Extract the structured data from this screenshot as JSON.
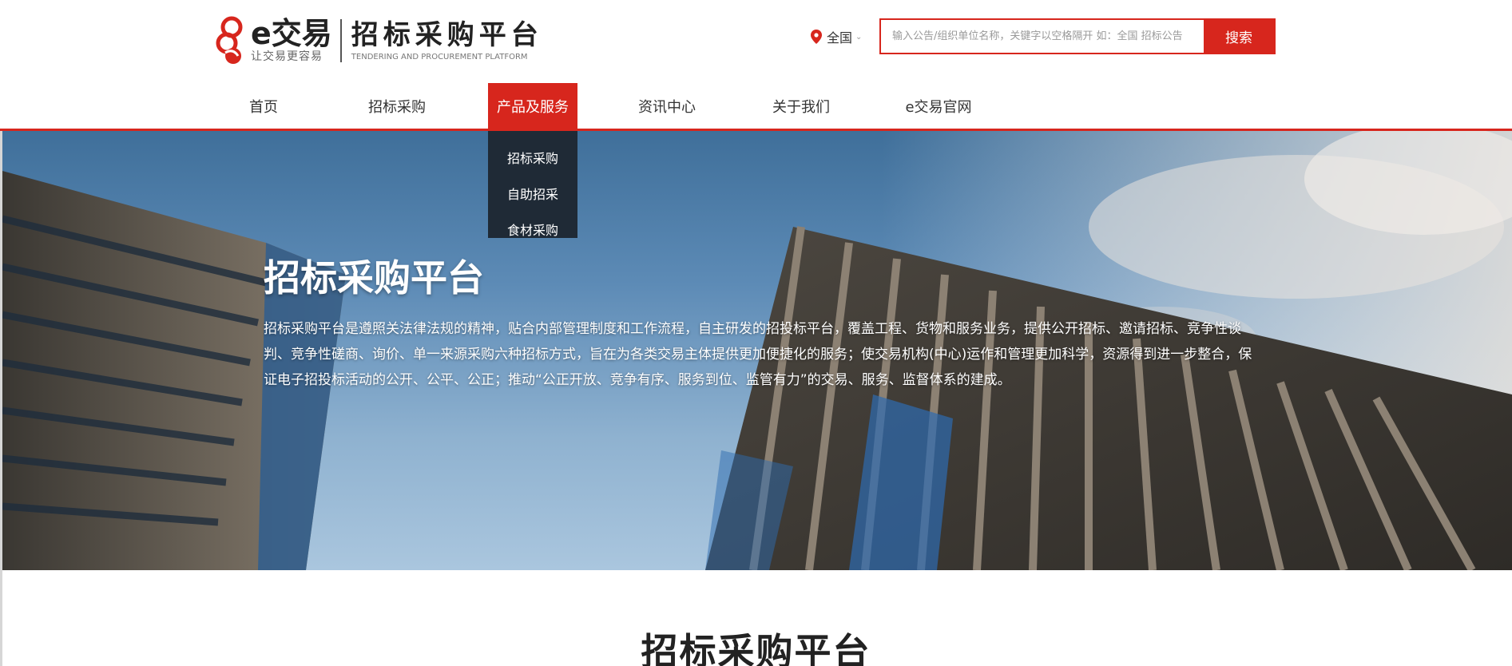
{
  "brand": {
    "e_name": "e交易",
    "slogan": "让交易更容易",
    "platform_name": "招标采购平台",
    "platform_en": "TENDERING AND PROCUREMENT PLATFORM",
    "accent_color": "#d7261d"
  },
  "header": {
    "region": {
      "label": "全国",
      "icon": "location-pin-icon"
    },
    "search": {
      "placeholder": "输入公告/组织单位名称，关键字以空格隔开 如：全国 招标公告",
      "button_label": "搜索"
    }
  },
  "nav": {
    "items": [
      {
        "label": "首页"
      },
      {
        "label": "招标采购"
      },
      {
        "label": "产品及服务",
        "active": true
      },
      {
        "label": "资讯中心"
      },
      {
        "label": "关于我们"
      },
      {
        "label": "e交易官网"
      }
    ]
  },
  "dropdown": {
    "items": [
      {
        "label": "招标采购"
      },
      {
        "label": "自助招采"
      },
      {
        "label": "食材采购"
      }
    ]
  },
  "hero": {
    "title": "招标采购平台",
    "description": "招标采购平台是遵照关法律法规的精神，贴合内部管理制度和工作流程，自主研发的招投标平台，覆盖工程、货物和服务业务，提供公开招标、邀请招标、竞争性谈判、竞争性磋商、询价、单一来源采购六种招标方式，旨在为各类交易主体提供更加便捷化的服务；使交易机构(中心)运作和管理更加科学，资源得到进一步整合，保证电子招投标活动的公开、公平、公正；推动“公正开放、竞争有序、服务到位、监管有力”的交易、服务、监督体系的建成。"
  },
  "section": {
    "title": "招标采购平台"
  }
}
